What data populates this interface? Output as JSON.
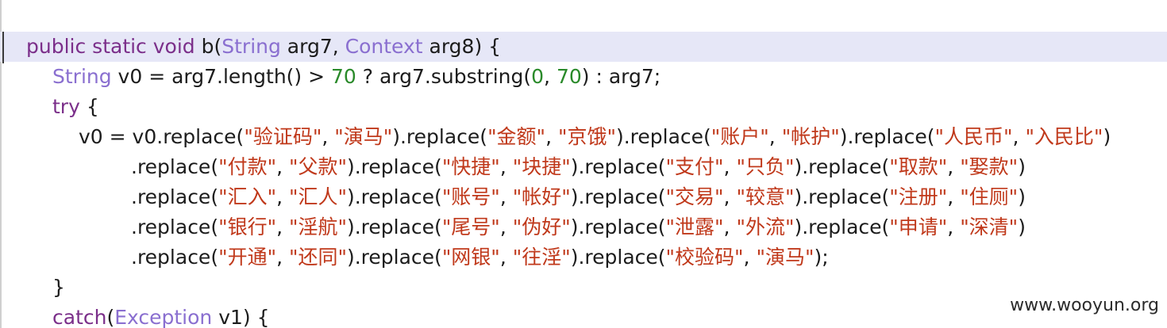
{
  "lines": [
    {
      "indent": 1,
      "highlight": true,
      "tokens": [
        {
          "t": "public static void",
          "c": "kw"
        },
        {
          "t": " b(",
          "c": "ident"
        },
        {
          "t": "String",
          "c": "type"
        },
        {
          "t": " arg7, ",
          "c": "ident"
        },
        {
          "t": "Context",
          "c": "type"
        },
        {
          "t": " arg8) {",
          "c": "ident"
        }
      ]
    },
    {
      "indent": 2,
      "tokens": [
        {
          "t": "String",
          "c": "type"
        },
        {
          "t": " v0 = arg7.length() > ",
          "c": "ident"
        },
        {
          "t": "70",
          "c": "num"
        },
        {
          "t": " ? arg7.substring(",
          "c": "ident"
        },
        {
          "t": "0",
          "c": "num"
        },
        {
          "t": ", ",
          "c": "ident"
        },
        {
          "t": "70",
          "c": "num"
        },
        {
          "t": ") : arg7;",
          "c": "ident"
        }
      ]
    },
    {
      "indent": 2,
      "tokens": [
        {
          "t": "try",
          "c": "kw"
        },
        {
          "t": " {",
          "c": "ident"
        }
      ]
    },
    {
      "indent": 3,
      "tokens": [
        {
          "t": "v0 = v0.replace(",
          "c": "ident"
        },
        {
          "t": "\"验证码\"",
          "c": "str"
        },
        {
          "t": ", ",
          "c": "ident"
        },
        {
          "t": "\"演马\"",
          "c": "str"
        },
        {
          "t": ").replace(",
          "c": "ident"
        },
        {
          "t": "\"金额\"",
          "c": "str"
        },
        {
          "t": ", ",
          "c": "ident"
        },
        {
          "t": "\"京饿\"",
          "c": "str"
        },
        {
          "t": ").replace(",
          "c": "ident"
        },
        {
          "t": "\"账户\"",
          "c": "str"
        },
        {
          "t": ", ",
          "c": "ident"
        },
        {
          "t": "\"帐护\"",
          "c": "str"
        },
        {
          "t": ").replace(",
          "c": "ident"
        },
        {
          "t": "\"人民币\"",
          "c": "str"
        },
        {
          "t": ", ",
          "c": "ident"
        },
        {
          "t": "\"入民比\"",
          "c": "str"
        },
        {
          "t": ")",
          "c": "ident"
        }
      ]
    },
    {
      "indent": 5,
      "tokens": [
        {
          "t": ".replace(",
          "c": "ident"
        },
        {
          "t": "\"付款\"",
          "c": "str"
        },
        {
          "t": ", ",
          "c": "ident"
        },
        {
          "t": "\"父款\"",
          "c": "str"
        },
        {
          "t": ").replace(",
          "c": "ident"
        },
        {
          "t": "\"快捷\"",
          "c": "str"
        },
        {
          "t": ", ",
          "c": "ident"
        },
        {
          "t": "\"块捷\"",
          "c": "str"
        },
        {
          "t": ").replace(",
          "c": "ident"
        },
        {
          "t": "\"支付\"",
          "c": "str"
        },
        {
          "t": ", ",
          "c": "ident"
        },
        {
          "t": "\"只负\"",
          "c": "str"
        },
        {
          "t": ").replace(",
          "c": "ident"
        },
        {
          "t": "\"取款\"",
          "c": "str"
        },
        {
          "t": ", ",
          "c": "ident"
        },
        {
          "t": "\"娶款\"",
          "c": "str"
        },
        {
          "t": ")",
          "c": "ident"
        }
      ]
    },
    {
      "indent": 5,
      "tokens": [
        {
          "t": ".replace(",
          "c": "ident"
        },
        {
          "t": "\"汇入\"",
          "c": "str"
        },
        {
          "t": ", ",
          "c": "ident"
        },
        {
          "t": "\"汇人\"",
          "c": "str"
        },
        {
          "t": ").replace(",
          "c": "ident"
        },
        {
          "t": "\"账号\"",
          "c": "str"
        },
        {
          "t": ", ",
          "c": "ident"
        },
        {
          "t": "\"帐好\"",
          "c": "str"
        },
        {
          "t": ").replace(",
          "c": "ident"
        },
        {
          "t": "\"交易\"",
          "c": "str"
        },
        {
          "t": ", ",
          "c": "ident"
        },
        {
          "t": "\"较意\"",
          "c": "str"
        },
        {
          "t": ").replace(",
          "c": "ident"
        },
        {
          "t": "\"注册\"",
          "c": "str"
        },
        {
          "t": ", ",
          "c": "ident"
        },
        {
          "t": "\"住厕\"",
          "c": "str"
        },
        {
          "t": ")",
          "c": "ident"
        }
      ]
    },
    {
      "indent": 5,
      "tokens": [
        {
          "t": ".replace(",
          "c": "ident"
        },
        {
          "t": "\"银行\"",
          "c": "str"
        },
        {
          "t": ", ",
          "c": "ident"
        },
        {
          "t": "\"淫航\"",
          "c": "str"
        },
        {
          "t": ").replace(",
          "c": "ident"
        },
        {
          "t": "\"尾号\"",
          "c": "str"
        },
        {
          "t": ", ",
          "c": "ident"
        },
        {
          "t": "\"伪好\"",
          "c": "str"
        },
        {
          "t": ").replace(",
          "c": "ident"
        },
        {
          "t": "\"泄露\"",
          "c": "str"
        },
        {
          "t": ", ",
          "c": "ident"
        },
        {
          "t": "\"外流\"",
          "c": "str"
        },
        {
          "t": ").replace(",
          "c": "ident"
        },
        {
          "t": "\"申请\"",
          "c": "str"
        },
        {
          "t": ", ",
          "c": "ident"
        },
        {
          "t": "\"深清\"",
          "c": "str"
        },
        {
          "t": ")",
          "c": "ident"
        }
      ]
    },
    {
      "indent": 5,
      "tokens": [
        {
          "t": ".replace(",
          "c": "ident"
        },
        {
          "t": "\"开通\"",
          "c": "str"
        },
        {
          "t": ", ",
          "c": "ident"
        },
        {
          "t": "\"还同\"",
          "c": "str"
        },
        {
          "t": ").replace(",
          "c": "ident"
        },
        {
          "t": "\"网银\"",
          "c": "str"
        },
        {
          "t": ", ",
          "c": "ident"
        },
        {
          "t": "\"往淫\"",
          "c": "str"
        },
        {
          "t": ").replace(",
          "c": "ident"
        },
        {
          "t": "\"校验码\"",
          "c": "str"
        },
        {
          "t": ", ",
          "c": "ident"
        },
        {
          "t": "\"演马\"",
          "c": "str"
        },
        {
          "t": ");",
          "c": "ident"
        }
      ]
    },
    {
      "indent": 2,
      "tokens": [
        {
          "t": "}",
          "c": "ident"
        }
      ]
    },
    {
      "indent": 2,
      "tokens": [
        {
          "t": "catch",
          "c": "kw"
        },
        {
          "t": "(",
          "c": "ident"
        },
        {
          "t": "Exception",
          "c": "type"
        },
        {
          "t": " v1) {",
          "c": "ident"
        }
      ]
    }
  ],
  "watermark": "www.wooyun.org",
  "colors": {
    "keyword": "#7b2f8a",
    "type": "#8a6fd0",
    "number": "#2a8a2a",
    "string": "#c0391b",
    "text": "#1c1c1c",
    "highlight": "#e6e7f7"
  }
}
